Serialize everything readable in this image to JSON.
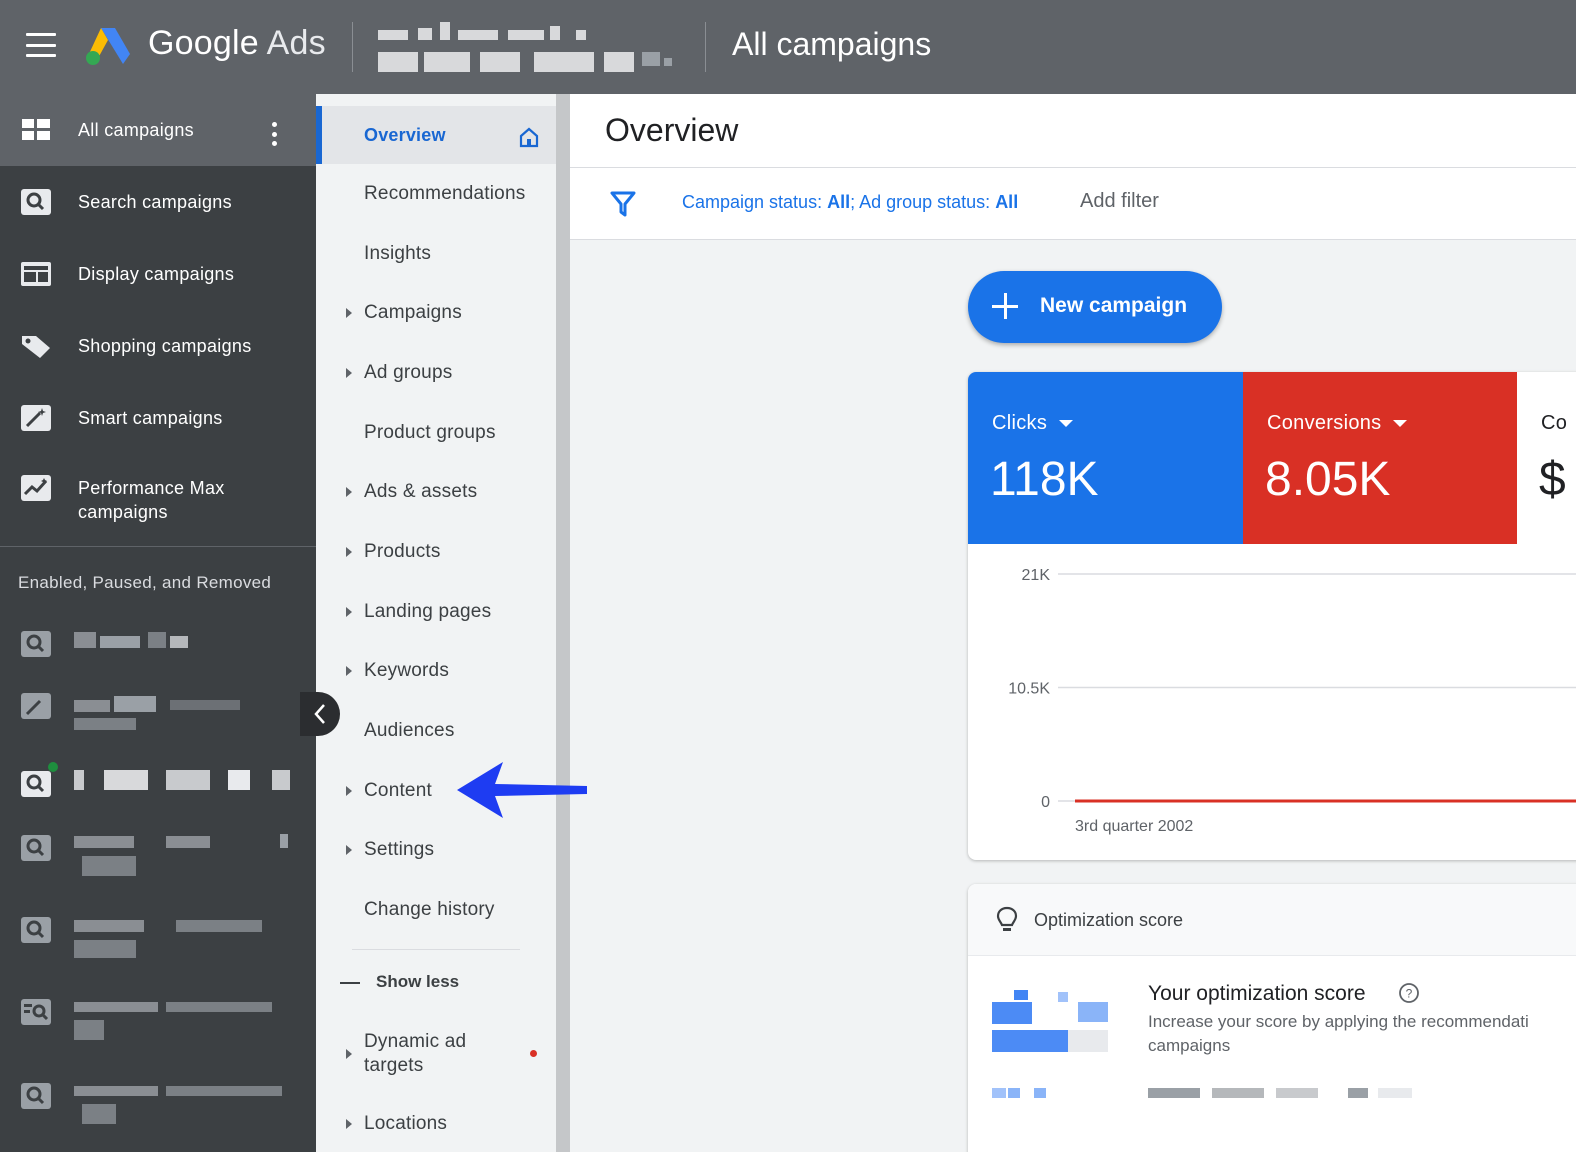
{
  "topbar": {
    "brand_google": "Google",
    "brand_ads": "Ads",
    "page_title": "All campaigns"
  },
  "leftnav": {
    "items": [
      {
        "label": "All campaigns",
        "icon": "grid-icon"
      },
      {
        "label": "Search campaigns",
        "icon": "search-icon"
      },
      {
        "label": "Display campaigns",
        "icon": "display-icon"
      },
      {
        "label": "Shopping campaigns",
        "icon": "tag-icon"
      },
      {
        "label": "Smart campaigns",
        "icon": "magic-wand-icon"
      },
      {
        "label": "Performance Max campaigns",
        "icon": "trending-icon"
      }
    ],
    "section_label": "Enabled, Paused, and Removed"
  },
  "pagemenu": {
    "items": [
      {
        "label": "Overview"
      },
      {
        "label": "Recommendations"
      },
      {
        "label": "Insights"
      },
      {
        "label": "Campaigns"
      },
      {
        "label": "Ad groups"
      },
      {
        "label": "Product groups"
      },
      {
        "label": "Ads & assets"
      },
      {
        "label": "Products"
      },
      {
        "label": "Landing pages"
      },
      {
        "label": "Keywords"
      },
      {
        "label": "Audiences"
      },
      {
        "label": "Content"
      },
      {
        "label": "Settings"
      },
      {
        "label": "Change history"
      }
    ],
    "show_less": "Show less",
    "extra_items": [
      {
        "label_line1": "Dynamic ad",
        "label_line2": "targets"
      },
      {
        "label": "Locations"
      }
    ]
  },
  "main": {
    "title": "Overview",
    "filter": {
      "campaign_status_label": "Campaign status: ",
      "campaign_status_value": "All",
      "adgroup_status_label": "; Ad group status: ",
      "adgroup_status_value": "All",
      "add_filter": "Add filter"
    },
    "new_campaign": "New campaign",
    "metrics": [
      {
        "name": "Clicks",
        "value": "118K",
        "color": "#1a73e8"
      },
      {
        "name": "Conversions",
        "value": "8.05K",
        "color": "#d93025"
      },
      {
        "name": "Co",
        "value": "$"
      }
    ],
    "optimization": {
      "header": "Optimization score",
      "title": "Your optimization score",
      "desc_line1": "Increase your score by applying the recommendati",
      "desc_line2": "campaigns"
    }
  },
  "chart_data": {
    "type": "line",
    "y_ticks": [
      "21K",
      "10.5K",
      "0"
    ],
    "ylim": [
      0,
      21000
    ],
    "x_label": "3rd quarter 2002",
    "series": [
      {
        "values": [
          0,
          0
        ],
        "color": "#d93025"
      }
    ]
  }
}
